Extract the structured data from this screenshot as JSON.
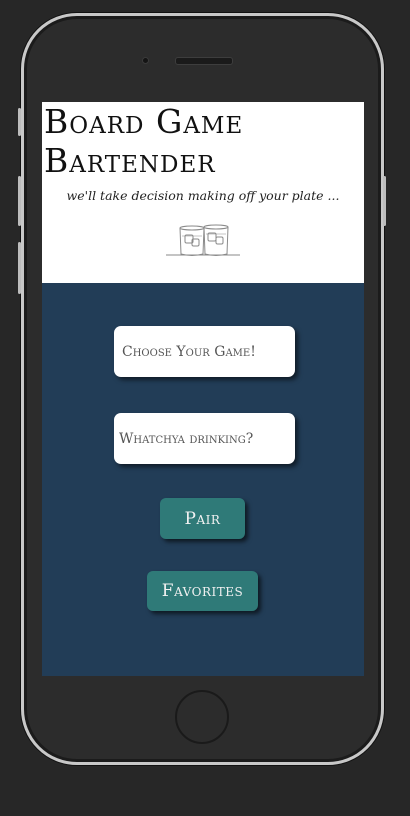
{
  "app": {
    "title": "Board Game Bartender",
    "tagline": "we'll take decision making off your plate ..."
  },
  "form": {
    "game_placeholder": "Choose Your Game!",
    "drink_placeholder": "Whatchya drinking?",
    "pair_label": "Pair",
    "favorites_label": "Favorites"
  },
  "colors": {
    "screen_bg": "#223d57",
    "button_bg": "#2f7a78",
    "header_bg": "#ffffff",
    "phone_body": "#2c2c2c"
  },
  "icons": {
    "logo": "two-glasses-icon"
  }
}
